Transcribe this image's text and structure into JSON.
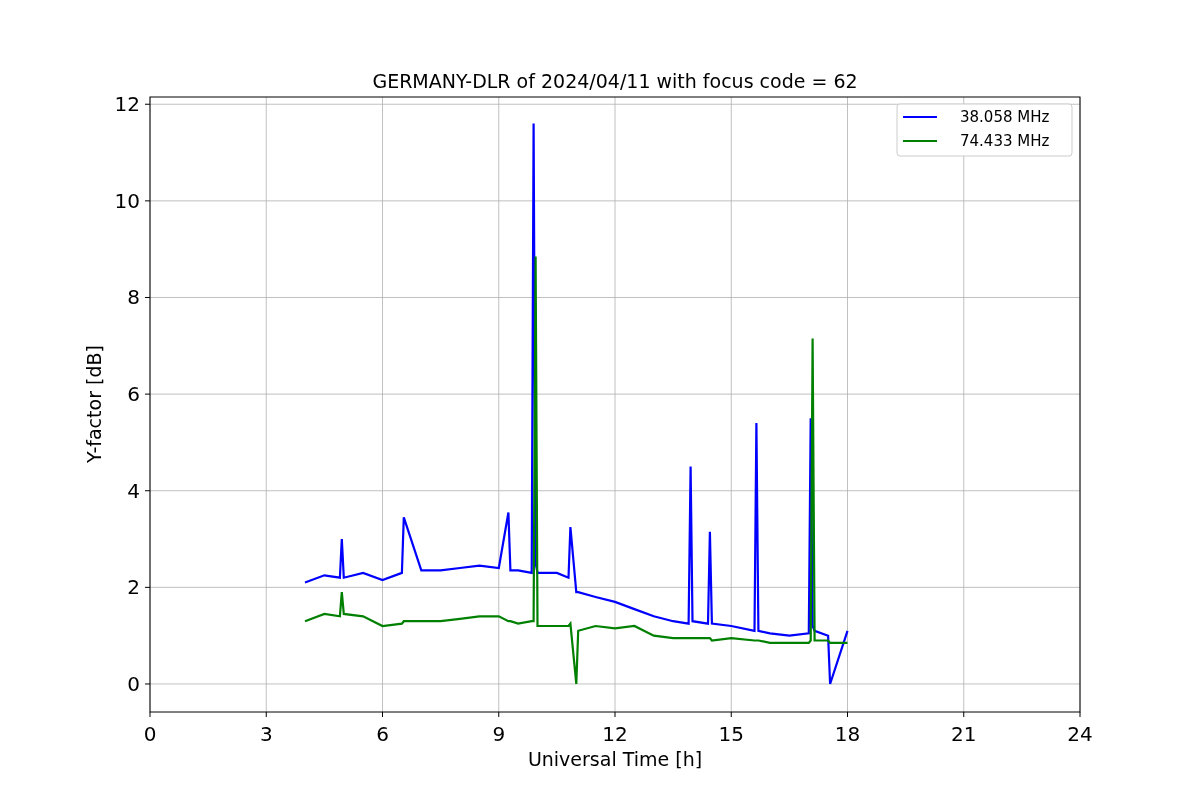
{
  "figure": {
    "chart_data": {
      "type": "line",
      "title": "GERMANY-DLR of 2024/04/11 with focus code = 62",
      "xlabel": "Universal Time [h]",
      "ylabel": "Y-factor [dB]",
      "x": [
        4,
        4.5,
        4.9,
        4.95,
        5,
        5.5,
        6,
        6.5,
        6.55,
        7,
        7.5,
        8,
        8.5,
        9,
        9.25,
        9.3,
        9.5,
        9.85,
        9.9,
        9.95,
        10,
        10.5,
        10.8,
        10.85,
        11,
        11.05,
        11.5,
        12,
        12.5,
        13,
        13.5,
        13.9,
        13.95,
        14,
        14.4,
        14.45,
        14.5,
        15,
        15.6,
        15.65,
        15.7,
        16,
        16.5,
        17,
        17.05,
        17.1,
        17.15,
        17.5,
        17.55,
        18
      ],
      "series": [
        {
          "name": "38.058 MHz",
          "color": "#0000ff",
          "values": [
            2.1,
            2.25,
            2.2,
            3.0,
            2.2,
            2.3,
            2.15,
            2.3,
            3.45,
            2.35,
            2.35,
            2.4,
            2.45,
            2.4,
            3.55,
            2.35,
            2.35,
            2.3,
            11.6,
            2.5,
            2.3,
            2.3,
            2.2,
            3.25,
            1.9,
            1.9,
            1.8,
            1.7,
            1.55,
            1.4,
            1.3,
            1.25,
            4.5,
            1.3,
            1.25,
            3.15,
            1.25,
            1.2,
            1.1,
            5.4,
            1.1,
            1.05,
            1.0,
            1.05,
            5.5,
            1.2,
            1.1,
            1.0,
            0.0,
            1.1
          ]
        },
        {
          "name": "74.433 MHz",
          "color": "#008000",
          "values": [
            1.3,
            1.45,
            1.4,
            1.9,
            1.45,
            1.4,
            1.2,
            1.25,
            1.3,
            1.3,
            1.3,
            1.35,
            1.4,
            1.4,
            1.3,
            1.3,
            1.25,
            1.3,
            1.3,
            8.85,
            1.2,
            1.2,
            1.2,
            1.25,
            0.0,
            1.1,
            1.2,
            1.15,
            1.2,
            1.0,
            0.95,
            0.95,
            0.95,
            0.95,
            0.95,
            0.95,
            0.9,
            0.95,
            0.9,
            0.9,
            0.9,
            0.85,
            0.85,
            0.85,
            0.9,
            7.15,
            0.9,
            0.9,
            0.85,
            0.85
          ]
        }
      ],
      "xlim": [
        0,
        24
      ],
      "ylim": [
        -0.58,
        12.15
      ],
      "xticks": [
        0,
        3,
        6,
        9,
        12,
        15,
        18,
        21,
        24
      ],
      "yticks": [
        0,
        2,
        4,
        6,
        8,
        10,
        12
      ],
      "grid": true,
      "legend": true
    }
  }
}
